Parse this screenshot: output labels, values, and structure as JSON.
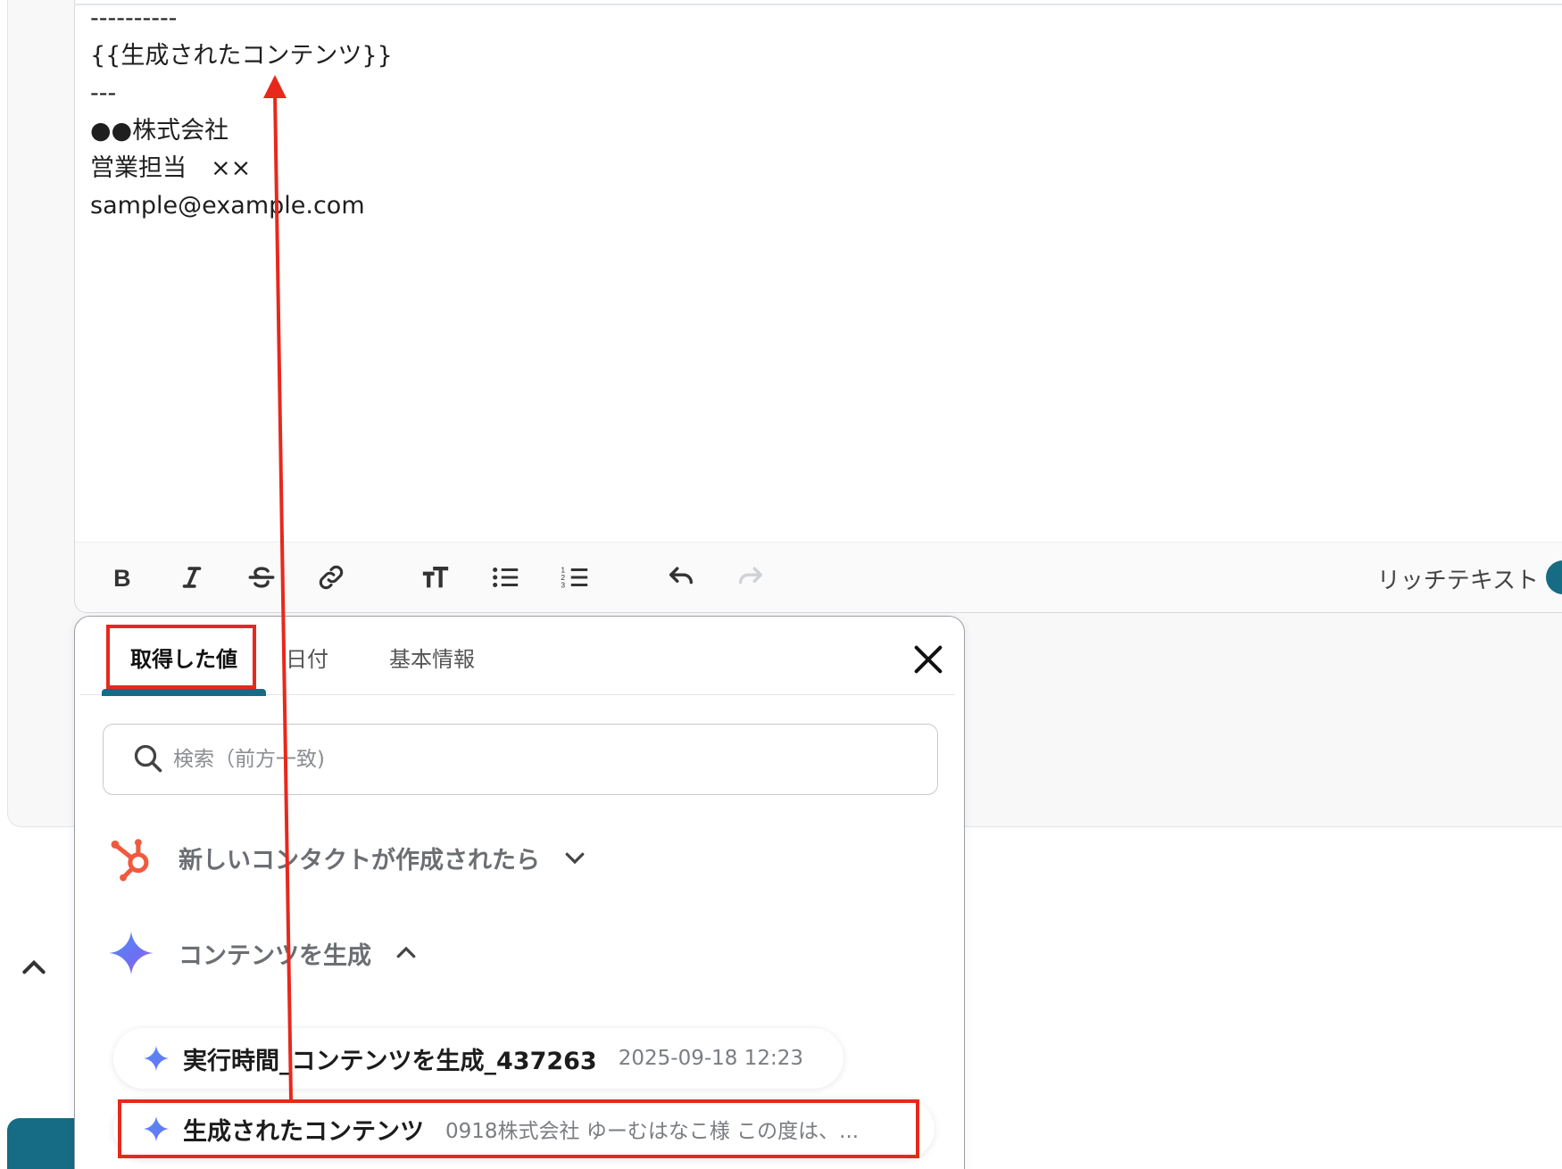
{
  "editor": {
    "lines": [
      "----------",
      "{{生成されたコンテンツ}}",
      "---",
      "●●株式会社",
      "営業担当　××",
      "sample@example.com"
    ],
    "toolbar": {
      "bold": "bold-icon",
      "italic": "italic-icon",
      "strike": "strikethrough-icon",
      "link": "link-icon",
      "text_size": "text-size-icon",
      "bullet_list": "bullet-list-icon",
      "numbered_list": "numbered-list-icon",
      "undo": "undo-icon",
      "redo": "redo-icon",
      "rich_text_label": "リッチテキスト"
    }
  },
  "popup": {
    "tabs": [
      {
        "label": "取得した値",
        "active": true
      },
      {
        "label": "日付",
        "active": false
      },
      {
        "label": "基本情報",
        "active": false
      }
    ],
    "search": {
      "placeholder": "検索（前方一致)",
      "value": ""
    },
    "groups": [
      {
        "label": "新しいコンタクトが作成されたら",
        "icon": "hubspot-icon",
        "expanded": false
      },
      {
        "label": "コンテンツを生成",
        "icon": "gemini-sparkle-icon",
        "expanded": true
      }
    ],
    "items": [
      {
        "name": "実行時間_コンテンツを生成_437263",
        "value": "2025-09-18 12:23"
      },
      {
        "name": "生成されたコンテンツ",
        "value": "0918株式会社 ゆーむはなこ様 この度は、..."
      }
    ]
  },
  "colors": {
    "accent": "#156c84",
    "annotation": "#e8281c",
    "hubspot": "#f0593e"
  }
}
